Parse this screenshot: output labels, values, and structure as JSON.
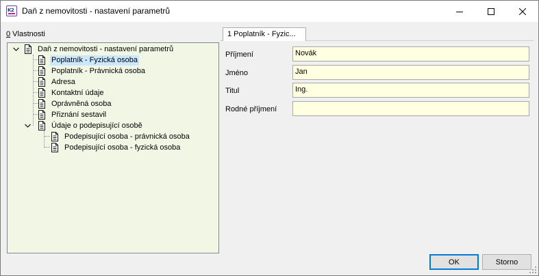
{
  "window": {
    "title": "Daň z nemovitosti - nastavení parametrů",
    "app_icon_text": "K2"
  },
  "left_panel": {
    "label_prefix": "0",
    "label_rest": " Vlastnosti"
  },
  "tree": {
    "root": "Daň z nemovitosti - nastavení parametrů",
    "items": [
      "Poplatník - Fyzická osoba",
      "Poplatník - Právnická osoba",
      "Adresa",
      "Kontaktní údaje",
      "Oprávněná osoba",
      "Přiznání sestavil",
      "Údaje o podepisující osobě"
    ],
    "sub_items": [
      "Podepisující osoba - právnická osoba",
      "Podepisující osoba - fyzická osoba"
    ]
  },
  "tab": {
    "label": "1 Poplatník - Fyzic..."
  },
  "form": {
    "fields": [
      {
        "label": "Příjmení",
        "value": "Novák"
      },
      {
        "label": "Jméno",
        "value": "Jan"
      },
      {
        "label": "Titul",
        "value": "Ing."
      },
      {
        "label": "Rodné příjmení",
        "value": ""
      }
    ]
  },
  "buttons": {
    "ok": "OK",
    "cancel": "Storno"
  },
  "colors": {
    "tree_background": "#f1f7e4",
    "input_background": "#ffffe1",
    "selection": "#cce8ff",
    "default_button_border": "#0078d7"
  }
}
